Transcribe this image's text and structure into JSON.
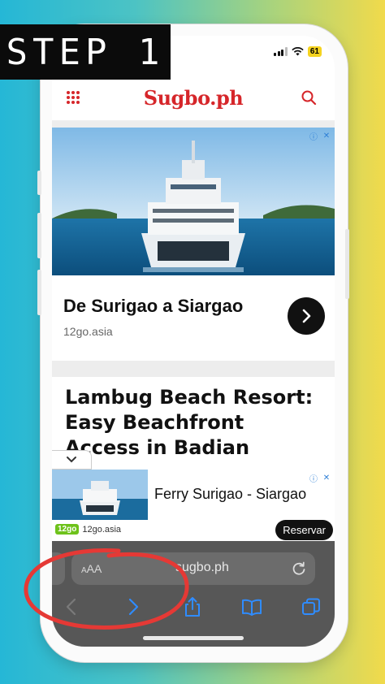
{
  "step_label": "STEP 1",
  "status_bar": {
    "battery": "61"
  },
  "site": {
    "logo": "Sugbo.ph"
  },
  "ad_top": {
    "title": "De Surigao a Siargao",
    "domain": "12go.asia"
  },
  "article": {
    "title": "Lambug Beach Resort: Easy Beachfront Access in Badian"
  },
  "banner_ad": {
    "title": "Ferry Surigao - Siargao",
    "brand_badge": "12go",
    "domain": "12go.asia",
    "cta": "Reservar"
  },
  "browser": {
    "text_size_label": "AA",
    "url": "sugbo.ph"
  },
  "colors": {
    "brand_red": "#d6262a",
    "annotation_red": "#e53935",
    "bar_gray": "#575757",
    "toolbar_blue": "#2f8cff"
  }
}
